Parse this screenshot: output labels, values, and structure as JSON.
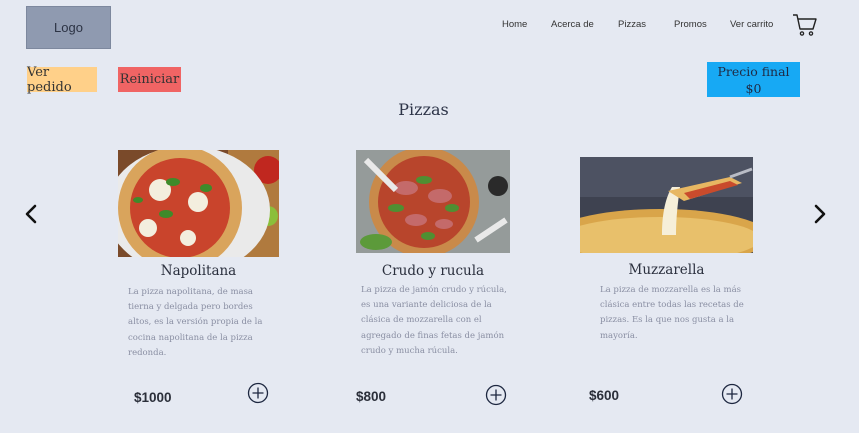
{
  "header": {
    "logo": "Logo",
    "nav": [
      {
        "label": "Home"
      },
      {
        "label": "Acerca de"
      },
      {
        "label": "Pizzas"
      },
      {
        "label": "Promos"
      },
      {
        "label": "Ver carrito"
      }
    ]
  },
  "actions": {
    "ver_pedido": "Ver pedido",
    "reiniciar": "Reiniciar",
    "precio_final_label": "Precio final",
    "precio_final_value": "$0"
  },
  "section": {
    "title": "Pizzas"
  },
  "products": [
    {
      "name": "Napolitana",
      "description_lines": [
        "La pizza napolitana, de masa",
        "tierna y delgada pero bordes",
        "altos, es la versión propia de la",
        "cocina napolitana de la pizza",
        "redonda."
      ],
      "price": "$1000"
    },
    {
      "name": "Crudo y  rucula",
      "description_lines": [
        "La pizza de jamón crudo y rúcula,",
        "es una variante deliciosa de la",
        "clásica de mozzarella con el",
        "agregado de finas fetas de jamón",
        "crudo y mucha rúcula."
      ],
      "price": "$800"
    },
    {
      "name": "Muzzarella",
      "description_lines": [
        "La pizza de mozzarella es la más",
        "clásica entre todas las recetas de",
        "pizzas. Es la que nos gusta a la",
        "mayoría."
      ],
      "price": "$600"
    }
  ],
  "colors": {
    "background": "#e5e9f2",
    "logo_bg": "#8f9ab0",
    "ver_pedido_bg": "#ffd089",
    "reiniciar_bg": "#f06464",
    "precio_bg": "#17a9f4"
  },
  "icons": {
    "cart": "cart-icon",
    "prev": "chevron-left-icon",
    "next": "chevron-right-icon",
    "add": "plus-circle-icon"
  }
}
